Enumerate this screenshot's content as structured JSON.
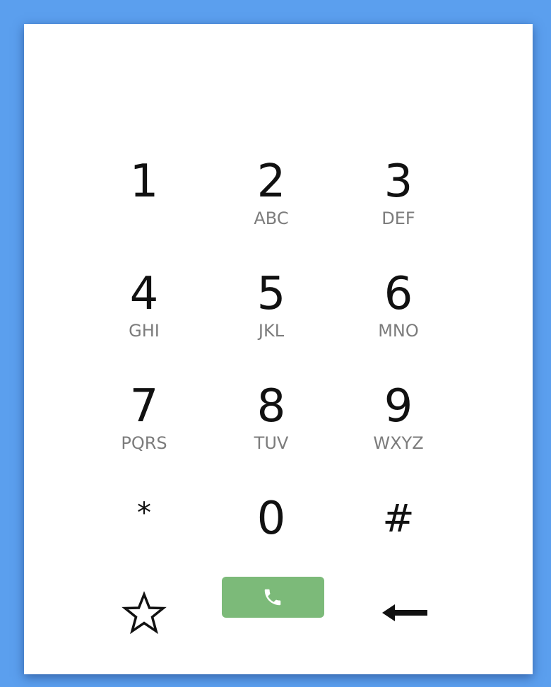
{
  "colors": {
    "background": "#5b9fee",
    "card": "#ffffff",
    "call_button": "#7cba79",
    "digit": "#111111",
    "letters": "#7c7c7c"
  },
  "keypad": {
    "keys": [
      {
        "digit": "1",
        "letters": ""
      },
      {
        "digit": "2",
        "letters": "ABC"
      },
      {
        "digit": "3",
        "letters": "DEF"
      },
      {
        "digit": "4",
        "letters": "GHI"
      },
      {
        "digit": "5",
        "letters": "JKL"
      },
      {
        "digit": "6",
        "letters": "MNO"
      },
      {
        "digit": "7",
        "letters": "PQRS"
      },
      {
        "digit": "8",
        "letters": "TUV"
      },
      {
        "digit": "9",
        "letters": "WXYZ"
      },
      {
        "digit": "*",
        "letters": ""
      },
      {
        "digit": "0",
        "letters": ""
      },
      {
        "digit": "#",
        "letters": ""
      }
    ]
  },
  "actions": {
    "favorite_icon": "star-outline-icon",
    "call_icon": "phone-icon",
    "backspace_icon": "arrow-left-icon"
  }
}
